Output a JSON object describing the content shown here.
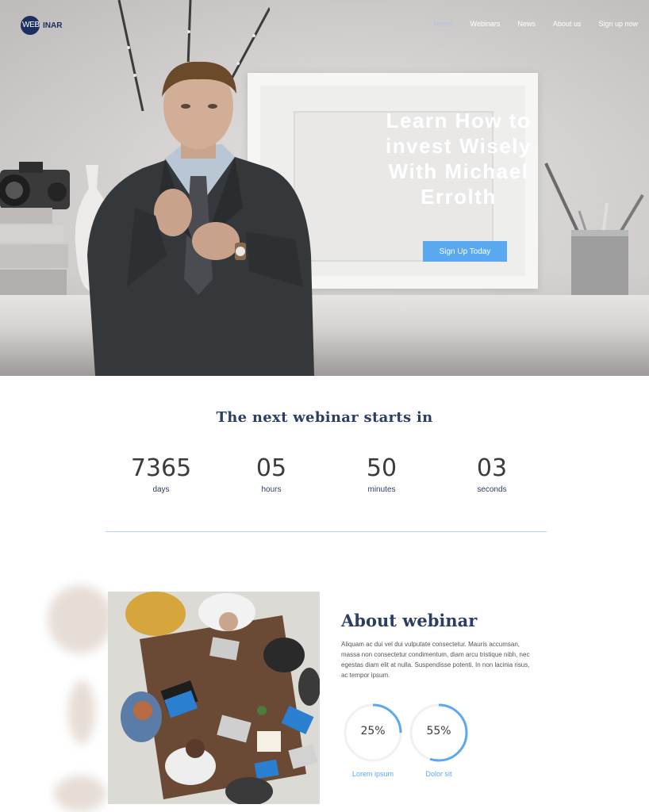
{
  "brand": {
    "logo_left": "WEB",
    "logo_right": "INAR",
    "accent": "#5aa8f0",
    "navy": "#1c2f63"
  },
  "nav": {
    "items": [
      {
        "label": "Home",
        "active": true
      },
      {
        "label": "Webinars",
        "active": false
      },
      {
        "label": "News",
        "active": false
      },
      {
        "label": "About us",
        "active": false
      },
      {
        "label": "Sign up now",
        "active": false
      }
    ]
  },
  "hero": {
    "title_lines": [
      "Learn How to",
      "invest Wisely",
      "With Michael",
      "Errolth"
    ],
    "cta_label": "Sign Up Today"
  },
  "countdown": {
    "title": "The next webinar starts in",
    "units": [
      {
        "value": "7365",
        "label": "days"
      },
      {
        "value": "05",
        "label": "hours"
      },
      {
        "value": "50",
        "label": "minutes"
      },
      {
        "value": "03",
        "label": "seconds"
      }
    ]
  },
  "about": {
    "title": "About webinar",
    "text": "Aliquam ac dui vel dui vulputate consectetur. Mauris accumsan, massa non consectetur condimentum, diam arcu tristique nibh, nec egestas diam elit at nulla. Suspendisse potenti. In non lacinia risus, ac tempor ipsum.",
    "stats": [
      {
        "percent_label": "25%",
        "value": 0.25,
        "label": "Lorem ipsum"
      },
      {
        "percent_label": "55%",
        "value": 0.55,
        "label": "Dolor sit"
      }
    ]
  }
}
